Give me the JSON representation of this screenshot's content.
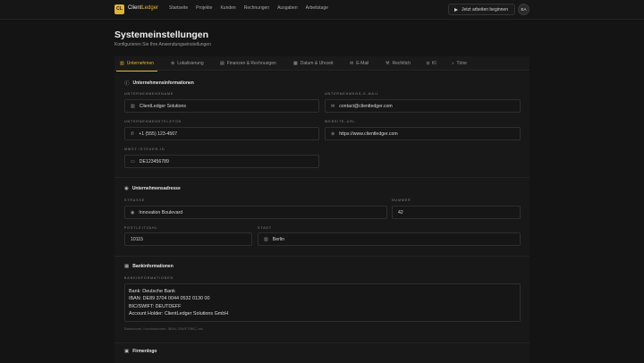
{
  "brand": {
    "badge": "CL",
    "name": "Client",
    "name_accent": "Ledger"
  },
  "nav": [
    "Startseite",
    "Projekte",
    "Kunden",
    "Rechnungen",
    "Ausgaben",
    "Arbeitstage"
  ],
  "header": {
    "start_button": "Jetzt arbeiten beginnen",
    "avatar": "EA"
  },
  "page": {
    "title": "Systemeinstellungen",
    "subtitle": "Konfigurieren Sie Ihre Anwendungseinstellungen"
  },
  "tabs": [
    {
      "label": "Unternehmen",
      "icon": "building-icon",
      "active": true
    },
    {
      "label": "Lokalisierung",
      "icon": "globe-icon"
    },
    {
      "label": "Finanzen & Rechnungen",
      "icon": "banknote-icon"
    },
    {
      "label": "Datum & Uhrzeit",
      "icon": "calendar-icon"
    },
    {
      "label": "E-Mail",
      "icon": "mail-icon"
    },
    {
      "label": "Rechtlich",
      "icon": "gavel-icon"
    },
    {
      "label": "KI",
      "icon": "robot-icon"
    },
    {
      "label": "Töne",
      "icon": "sound-icon"
    }
  ],
  "company_info": {
    "title": "Unternehmensinformationen",
    "name_label": "UNTERNEHMENSNAME",
    "name_value": "ClientLedger Solutions",
    "email_label": "UNTERNEHMENS-E-MAIL",
    "email_value": "contact@clientledger.com",
    "phone_label": "UNTERNEHMENSTELEFON",
    "phone_value": "+1 (555) 123-4567",
    "website_label": "WEBSITE-URL",
    "website_value": "https://www.clientledger.com",
    "vat_label": "MWST./STEUER-ID",
    "vat_value": "DE123456789"
  },
  "address": {
    "title": "Unternehmensadresse",
    "street_label": "STRASSE",
    "street_value": "Innovation Boulevard",
    "number_label": "NUMMER",
    "number_value": "42",
    "zip_label": "POSTLEITZAHL",
    "zip_value": "10115",
    "city_label": "STADT",
    "city_value": "Berlin"
  },
  "bank": {
    "title": "Bankinformationen",
    "label": "BANKINFORMATIONEN",
    "lines": [
      "Bank: Deutsche Bank",
      "IBAN: DE89 3704 0044 0532 0130 00",
      "BIC/SWIFT: DEUTDEFF",
      "Account Holder: ClientLedger Solutions GmbH"
    ],
    "hint": "Bankname, Kontonummer, IBAN, SWIFT/BIC, etc."
  },
  "logo": {
    "title": "Firmenlogo"
  },
  "colors": {
    "accent": "#e0b335",
    "background": "#141414"
  }
}
